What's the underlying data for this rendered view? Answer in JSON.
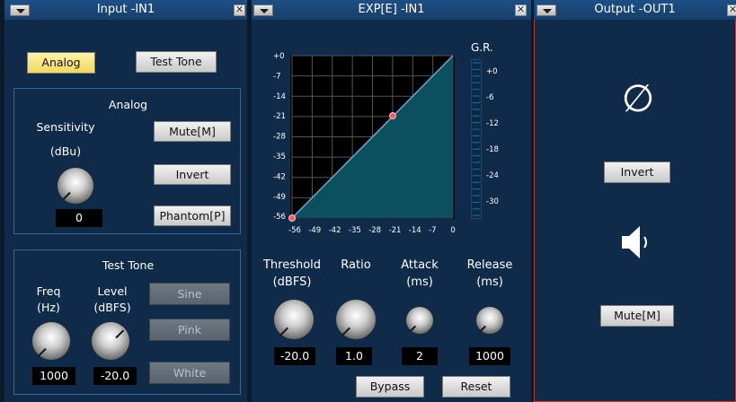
{
  "input": {
    "title": "Input -IN1",
    "close": "✕",
    "source_buttons": {
      "analog": "Analog",
      "test_tone": "Test Tone"
    },
    "analog": {
      "heading": "Analog",
      "sensitivity_label": "Sensitivity",
      "sensitivity_unit": "(dBu)",
      "sensitivity_value": "0",
      "mute_label": "Mute[M]",
      "invert_label": "Invert",
      "phantom_label": "Phantom[P]"
    },
    "test_tone": {
      "heading": "Test Tone",
      "freq_label": "Freq",
      "freq_unit": "(Hz)",
      "freq_value": "1000",
      "level_label": "Level",
      "level_unit": "(dBFS)",
      "level_value": "-20.0",
      "sine_label": "Sine",
      "pink_label": "Pink",
      "white_label": "White"
    }
  },
  "exp": {
    "title": "EXP[E] -IN1",
    "close": "✕",
    "graph": {
      "y_ticks": [
        "+0",
        "-7",
        "-14",
        "-21",
        "-28",
        "-35",
        "-42",
        "-49",
        "-56"
      ],
      "x_ticks": [
        "-56",
        "-49",
        "-42",
        "-35",
        "-28",
        "-21",
        "-14",
        "-7",
        "0"
      ]
    },
    "gr": {
      "label": "G.R.",
      "ticks": [
        "+0",
        "-6",
        "-12",
        "-18",
        "-24",
        "-30"
      ]
    },
    "threshold_label": "Threshold",
    "threshold_unit": "(dBFS)",
    "threshold_value": "-20.0",
    "ratio_label": "Ratio",
    "ratio_value": "1.0",
    "attack_label": "Attack",
    "attack_unit": "(ms)",
    "attack_value": "2",
    "release_label": "Release",
    "release_unit": "(ms)",
    "release_value": "1000",
    "bypass_label": "Bypass",
    "reset_label": "Reset"
  },
  "output": {
    "title": "Output -OUT1",
    "close": "✕",
    "phase_symbol": "∅",
    "invert_label": "Invert",
    "mute_label": "Mute[M]"
  },
  "colors": {
    "panel_bg": "#0f2b49",
    "graph_bg": "#000000",
    "curve_fill": "#0c4f5f",
    "accent_active": "#f1d85d",
    "output_border": "#c0392b"
  }
}
